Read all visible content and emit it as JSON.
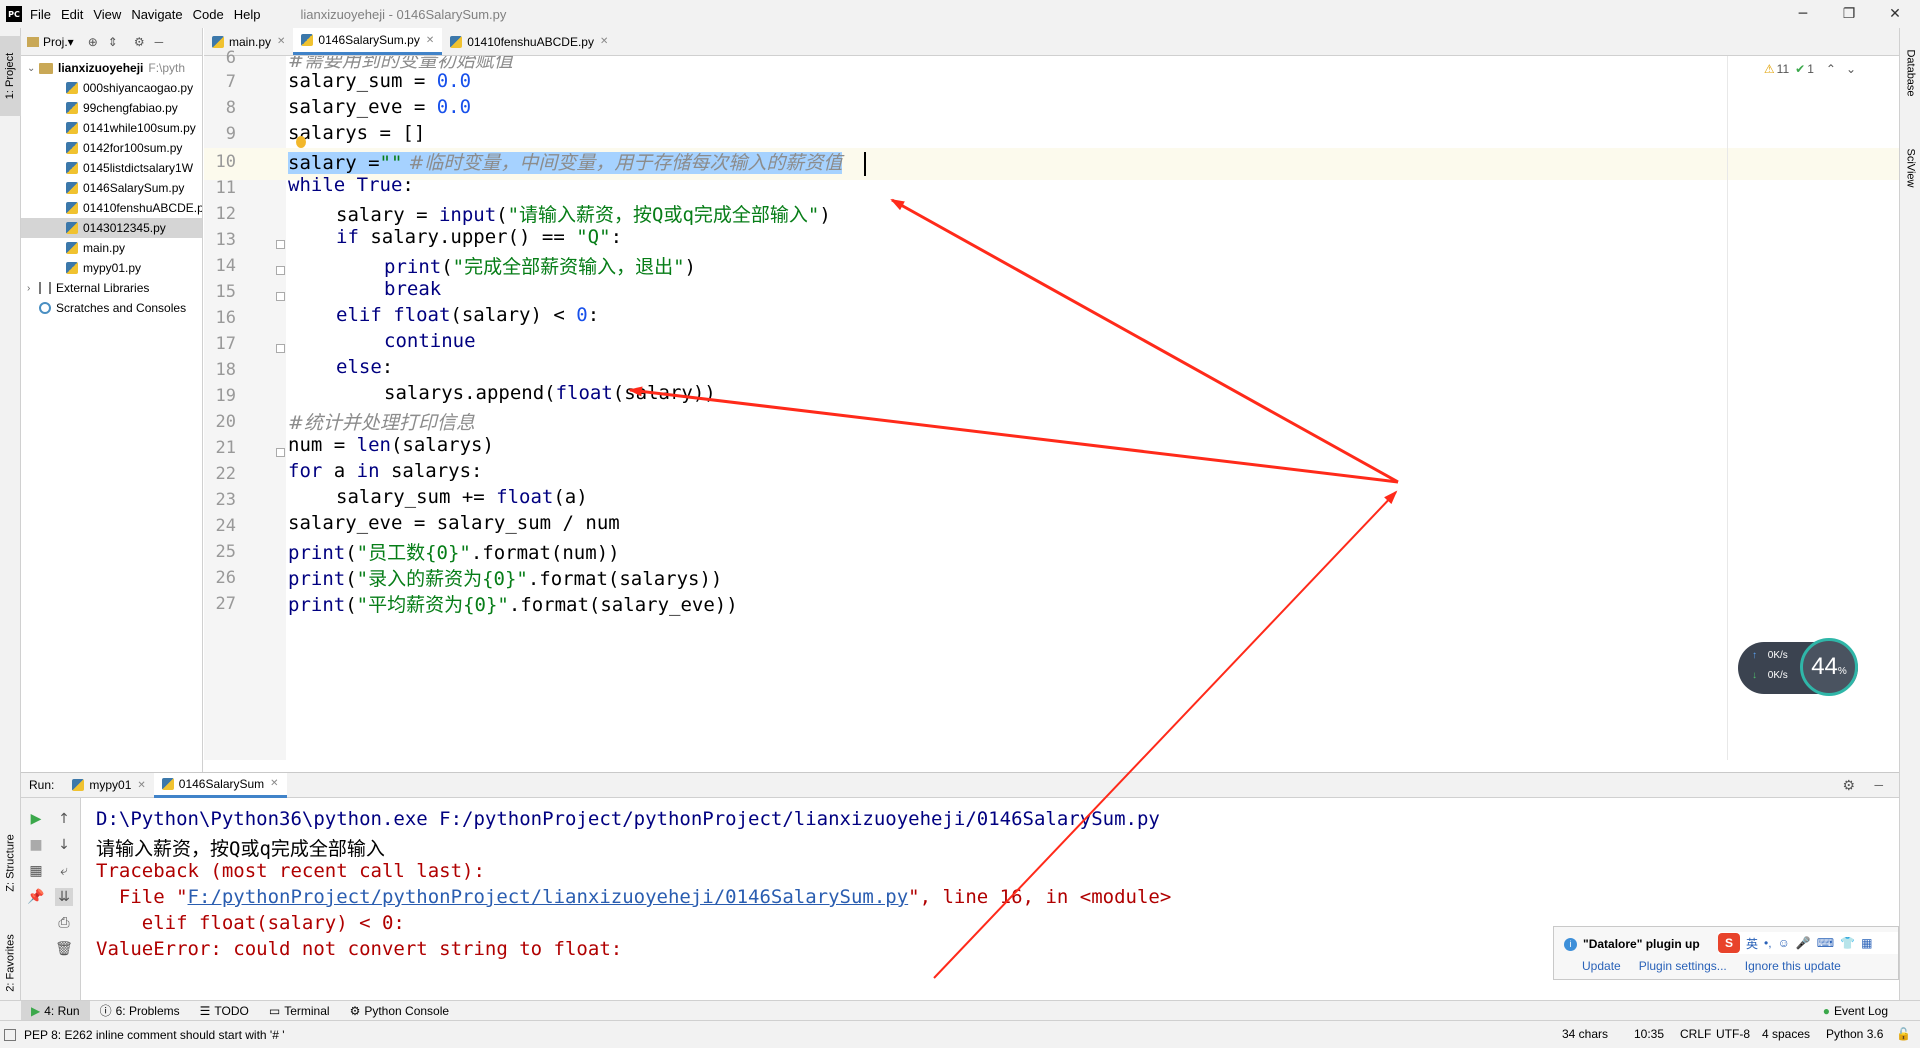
{
  "titlebar": {
    "app_icon": "PC",
    "menu": [
      "File",
      "Edit",
      "View",
      "Navigate",
      "Code",
      "Help"
    ],
    "title": "lianxizuoyeheji - 0146SalarySum.py",
    "minimize": "─",
    "maximize": "❐",
    "close": "✕"
  },
  "left_stripe": {
    "project_tab": "1: Project",
    "structure_tab": "Z: Structure",
    "favorites_tab": "2: Favorites"
  },
  "right_stripe": {
    "database_tab": "Database",
    "sciview_tab": "SciView"
  },
  "project_panel": {
    "toolbar_label": "Proj.▾",
    "root_name": "lianxizuoyeheji",
    "root_path": "F:\\pyth",
    "files": [
      "000shiyancaogao.py",
      "99chengfabiao.py",
      "0141while100sum.py",
      "0142for100sum.py",
      "0145listdictsalary1W",
      "0146SalarySum.py",
      "01410fenshuABCDE.p",
      "0143012345.py",
      "main.py",
      "mypy01.py"
    ],
    "selected_index": 7,
    "external_libraries": "External Libraries",
    "scratches": "Scratches and Consoles"
  },
  "editor_tabs": [
    {
      "label": "main.py",
      "active": false
    },
    {
      "label": "0146SalarySum.py",
      "active": true
    },
    {
      "label": "01410fenshuABCDE.py",
      "active": false
    }
  ],
  "inspection": {
    "warnings": "11",
    "weak_warnings": "1"
  },
  "code": {
    "line_numbers": [
      "6",
      "7",
      "8",
      "9",
      "10",
      "11",
      "12",
      "13",
      "14",
      "15",
      "16",
      "17",
      "18",
      "19",
      "20",
      "21",
      "22",
      "23",
      "24",
      "25",
      "26",
      "27"
    ],
    "current_line": "10",
    "l6_comment": "#需要用到的变量初始赋值",
    "l7_a": "salary_sum = ",
    "l7_b": "0.0",
    "l8_a": "salary_eve = ",
    "l8_b": "0.0",
    "l9": "salarys = []",
    "l10_a": "salary =",
    "l10_b": "\"\"",
    "l10_c": " #临时变量，中间变量，用于存储每次输入的薪资值",
    "l11_a": "while",
    "l11_b": " True",
    "l11_c": ":",
    "l12_a": "salary = ",
    "l12_b": "input",
    "l12_c": "(",
    "l12_d": "\"请输入薪资，按Q或q完成全部输入\"",
    "l12_e": ")",
    "l13_a": "if",
    "l13_b": " salary.upper() == ",
    "l13_c": "\"Q\"",
    "l13_d": ":",
    "l14_a": "print",
    "l14_b": "(",
    "l14_c": "\"完成全部薪资输入，退出\"",
    "l14_d": ")",
    "l15": "break",
    "l16_a": "elif",
    "l16_b": " float",
    "l16_c": "(salary) < ",
    "l16_d": "0",
    "l16_e": ":",
    "l17": "continue",
    "l18_a": "else",
    "l18_b": ":",
    "l19_a": "salarys.append(",
    "l19_b": "float",
    "l19_c": "(salary))",
    "l20_comment": "#统计并处理打印信息",
    "l21_a": "num = ",
    "l21_b": "len",
    "l21_c": "(salarys)",
    "l22_a": "for",
    "l22_b": " a ",
    "l22_c": "in",
    "l22_d": " salarys:",
    "l23_a": "salary_sum += ",
    "l23_b": "float",
    "l23_c": "(a)",
    "l24": "salary_eve = salary_sum / num",
    "l25_a": "print",
    "l25_b": "(",
    "l25_c": "\"员工数{0}\"",
    "l25_d": ".format(num))",
    "l26_a": "print",
    "l26_b": "(",
    "l26_c": "\"录入的薪资为{0}\"",
    "l26_d": ".format(salarys))",
    "l27_a": "print",
    "l27_b": "(",
    "l27_c": "\"平均薪资为{0}\"",
    "l27_d": ".format(salary_eve))"
  },
  "net_widget": {
    "upload": "0K/s",
    "download": "0K/s",
    "percent": "44",
    "percent_unit": "%"
  },
  "run_panel": {
    "label": "Run:",
    "tabs": [
      "mypy01",
      "0146SalarySum"
    ],
    "active_tab": 1,
    "settings_icon": "gear-icon",
    "console": {
      "cmd": "D:\\Python\\Python36\\python.exe F:/pythonProject/pythonProject/lianxizuoyeheji/0146SalarySum.py",
      "prompt": "请输入薪资，按Q或q完成全部输入",
      "traceback": "Traceback (most recent call last):",
      "file_prefix": "  File \"",
      "file_link": "F:/pythonProject/pythonProject/lianxizuoyeheji/0146SalarySum.py",
      "file_suffix": "\", line 16, in <module>",
      "code_line": "    elif float(salary) < 0:",
      "error": "ValueError: could not convert string to float:"
    }
  },
  "notification": {
    "title": "\"Datalore\" plugin up",
    "actions": [
      "Update",
      "Plugin settings...",
      "Ignore this update"
    ],
    "ime_label": "英"
  },
  "bottom_tools": [
    {
      "label": "4: Run",
      "active": true
    },
    {
      "label": "6: Problems",
      "active": false
    },
    {
      "label": "TODO",
      "active": false
    },
    {
      "label": "Terminal",
      "active": false
    },
    {
      "label": "Python Console",
      "active": false
    }
  ],
  "event_log": "Event Log",
  "statusbar": {
    "message": "PEP 8: E262 inline comment should start with '# '",
    "chars": "34 chars",
    "position": "10:35",
    "line_sep": "CRLF",
    "encoding": "UTF-8",
    "indent": "4 spaces",
    "interpreter": "Python 3.6"
  },
  "colors": {
    "accent": "#4083c9",
    "keyword": "#000080",
    "string": "#067d17",
    "number": "#1750eb",
    "comment": "#8c8c8c",
    "error": "#b00000",
    "annotation_arrow": "#ff2a1a"
  }
}
